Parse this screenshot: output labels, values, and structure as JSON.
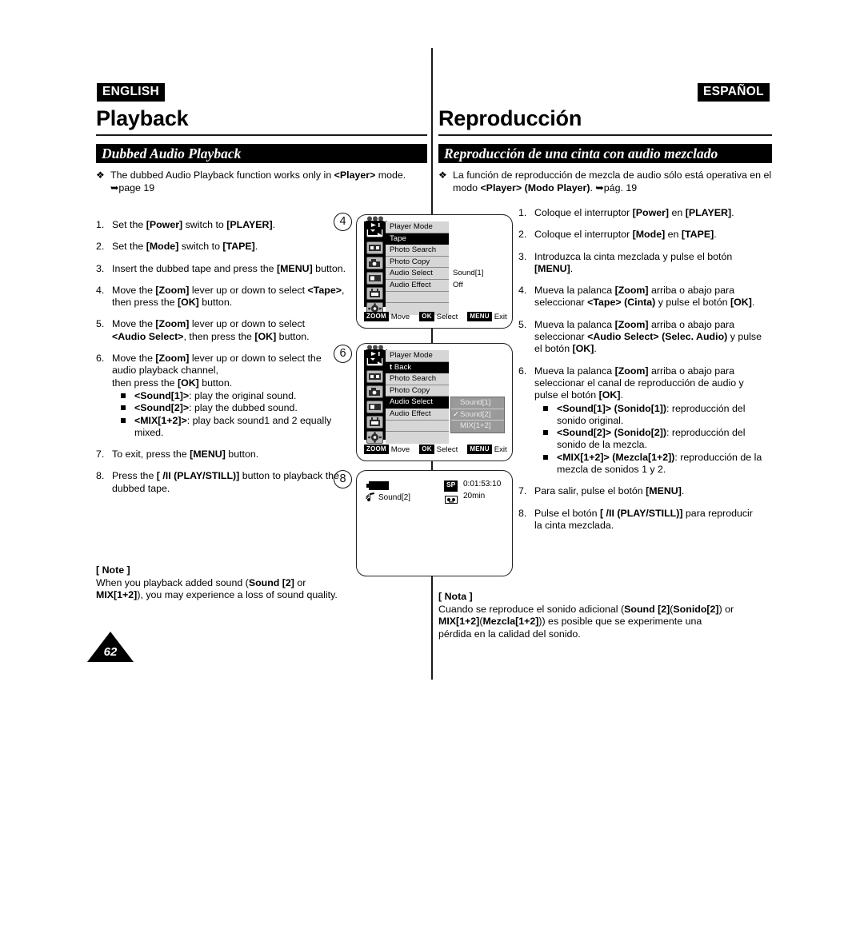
{
  "languages": {
    "english": "ENGLISH",
    "spanish": "ESPAÑOL"
  },
  "chapters": {
    "english": "Playback",
    "spanish": "Reproducción"
  },
  "sections": {
    "english": "Dubbed Audio Playback",
    "spanish": "Reproducción de una cinta con audio mezclado"
  },
  "intro": {
    "english_html": "The dubbed Audio Playback function works only in <b>&lt;Player&gt;</b> mode.<br>➥page 19",
    "spanish_html": "La función de reproducción de mezcla de audio sólo está operativa en el modo <b>&lt;Player&gt;</b> <b>(Modo Player)</b>. ➥pág. 19",
    "english_plain": "The dubbed Audio Playback function works only in <Player> mode. ➥page 19",
    "spanish_plain": "La función de reproducción de mezcla de audio sólo está operativa en el modo <Player> (Modo Player). ➥pág. 19",
    "diamond": "❖"
  },
  "steps_english": [
    {
      "num": "1.",
      "html": "Set the <b>[Power]</b> switch to <b>[PLAYER]</b>."
    },
    {
      "num": "2.",
      "html": "Set the <b>[Mode]</b> switch to <b>[TAPE]</b>."
    },
    {
      "num": "3.",
      "html": "Insert the dubbed tape and press the <b>[MENU]</b> button."
    },
    {
      "num": "4.",
      "html": "Move the <b>[Zoom]</b> lever up or down to select <b>&lt;Tape&gt;</b>,<br>then press the <b>[OK]</b> button."
    },
    {
      "num": "5.",
      "html": "Move the <b>[Zoom]</b> lever up or down to select<br><b>&lt;Audio Select&gt;</b>, then press the <b>[OK]</b> button."
    },
    {
      "num": "6.",
      "html": "Move the <b>[Zoom]</b> lever up or down to select the<br>audio playback channel,<br>then press the <b>[OK]</b> button.",
      "subitems": [
        "<b>&lt;Sound[1]&gt;</b>: play the original sound.",
        "<b>&lt;Sound[2]&gt;</b>: play the dubbed sound.",
        "<b>&lt;MIX[1+2]&gt;</b>: play back sound1 and 2 equally<br>mixed."
      ]
    },
    {
      "num": "7.",
      "html": "To exit, press the <b>[MENU]</b> button."
    },
    {
      "num": "8.",
      "html": "Press the <b>[  &#x2F;II (PLAY/STILL)]</b> button to playback the<br>dubbed tape."
    }
  ],
  "steps_spanish": [
    {
      "num": "1.",
      "html": "Coloque el interruptor <b>[Power]</b> en <b>[PLAYER]</b>."
    },
    {
      "num": "2.",
      "html": "Coloque el interruptor <b>[Mode]</b> en <b>[TAPE]</b>."
    },
    {
      "num": "3.",
      "html": "Introduzca la cinta mezclada y pulse el botón<br><b>[MENU]</b>."
    },
    {
      "num": "4.",
      "html": "Mueva la palanca <b>[Zoom]</b> arriba o abajo para<br>seleccionar <b>&lt;Tape&gt;</b> <b>(Cinta)</b> y pulse el botón <b>[OK]</b>."
    },
    {
      "num": "5.",
      "html": "Mueva la palanca <b>[Zoom]</b> arriba o abajo para<br>seleccionar <b>&lt;Audio Select&gt;</b> <b>(Selec. Audio)</b> y pulse<br>el botón <b>[OK]</b>."
    },
    {
      "num": "6.",
      "html": "Mueva la palanca <b>[Zoom]</b> arriba o abajo para<br>seleccionar el canal de reproducción de audio y<br>pulse el botón <b>[OK]</b>.",
      "subitems": [
        "<b>&lt;Sound[1]&gt;</b> <b>(Sonido[1])</b>: reproducción del<br>sonido original.",
        "<b>&lt;Sound[2]&gt;</b> <b>(Sonido[2])</b>: reproducción del<br>sonido de la mezcla.",
        "<b>&lt;MIX[1+2]&gt;</b> <b>(Mezcla[1+2])</b>: reproducción de la<br>mezcla de sonidos 1 y 2."
      ]
    },
    {
      "num": "7.",
      "html": "Para salir, pulse el botón <b>[MENU]</b>."
    },
    {
      "num": "8.",
      "html": "Pulse el botón <b>[  &#x2F;II (PLAY/STILL)]</b> para reproducir<br>la cinta mezclada."
    }
  ],
  "note_english": {
    "title": "[ Note ]",
    "html": "When you playback added sound (<b>Sound [2]</b> or<br><b>MIX[1+2]</b>), you may experience a loss of sound quality.",
    "plain": "When you playback added sound (Sound [2] or MIX[1+2]), you may experience a loss of sound quality."
  },
  "note_spanish": {
    "title": "[ Nota ]",
    "html": "Cuando se reproduce el sonido adicional (<b>Sound [2]</b>(<b>Sonido[2]</b>) or<br><b>MIX[1+2]</b>(<b>Mezcla[1+2]</b>)) es posible que se experimente una<br>pérdida en la calidad del sonido.",
    "plain": "Cuando se reproduce el sonido adicional (Sound [2](Sonido[2]) or MIX[1+2](Mezcla[1+2])) es posible que se experimente una pérdida en la calidad del sonido."
  },
  "page_number": "62",
  "step_markers": {
    "four": "4",
    "six": "6",
    "eight": "8"
  },
  "lcd_screen_1": {
    "title": "Player Mode",
    "items": [
      {
        "label": "Tape",
        "state": "selected",
        "value": ""
      },
      {
        "label": "Photo Search",
        "state": "normal",
        "value": ""
      },
      {
        "label": "Photo Copy",
        "state": "normal",
        "value": ""
      },
      {
        "label": "Audio Select",
        "state": "normal",
        "value": "Sound[1]"
      },
      {
        "label": "Audio Effect",
        "state": "normal",
        "value": "Off"
      }
    ],
    "guide": [
      {
        "key": "ZOOM",
        "label": "Move"
      },
      {
        "key": "OK",
        "label": "Select"
      },
      {
        "key": "MENU",
        "label": "Exit"
      }
    ]
  },
  "lcd_screen_2": {
    "title": "Player Mode",
    "items": [
      {
        "label": "Back",
        "state": "selected",
        "prefix": "t"
      },
      {
        "label": "Photo Search",
        "state": "normal"
      },
      {
        "label": "Photo Copy",
        "state": "normal"
      },
      {
        "label": "Audio Select",
        "state": "highlighted"
      },
      {
        "label": "Audio Effect",
        "state": "normal"
      }
    ],
    "submenu": [
      {
        "label": "Sound[1]",
        "checked": false
      },
      {
        "label": "Sound[2]",
        "checked": true
      },
      {
        "label": "MIX[1+2]",
        "checked": false
      }
    ],
    "check_glyph": "✓",
    "guide": [
      {
        "key": "ZOOM",
        "label": "Move"
      },
      {
        "key": "OK",
        "label": "Select"
      },
      {
        "key": "MENU",
        "label": "Exit"
      }
    ]
  },
  "lcd_screen_3": {
    "sound_label": "Sound[2]",
    "record_mode": "SP",
    "timecode": "0:01:53:10",
    "tape_remaining": "20min"
  },
  "colors": {
    "ink": "#000000",
    "paper": "#ffffff",
    "lcd_menu_bg": "#d6d6d6",
    "lcd_submenu_bg": "#9a9a9a",
    "lcd_icon_bg": "#b9b9b9"
  }
}
